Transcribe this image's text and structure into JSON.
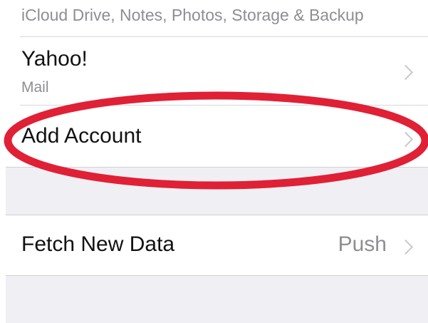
{
  "icloud_row": {
    "subtitle": "iCloud Drive, Notes, Photos, Storage & Backup"
  },
  "yahoo_row": {
    "title": "Yahoo!",
    "subtitle": "Mail"
  },
  "add_account_row": {
    "title": "Add Account"
  },
  "fetch_row": {
    "title": "Fetch New Data",
    "value": "Push"
  },
  "colors": {
    "highlight_oval": "#e02035",
    "background": "#efeff4",
    "secondary_text": "#8e8e93",
    "chevron": "#c7c7cc"
  },
  "icons": {
    "chevron": "chevron-right-icon"
  }
}
